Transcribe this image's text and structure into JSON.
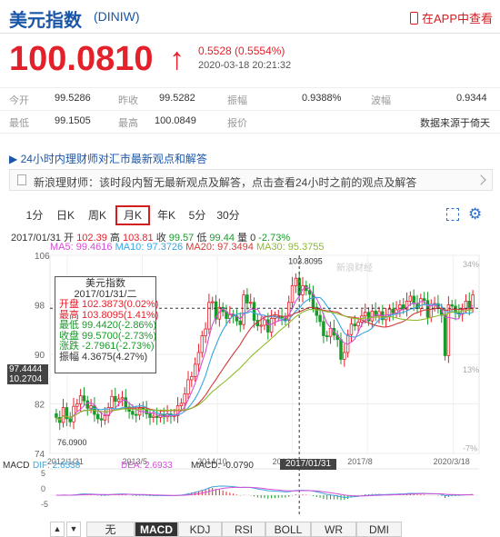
{
  "header": {
    "title": "美元指数",
    "code": "(DINIW)",
    "app_link": "在APP中查看"
  },
  "price": {
    "value": "100.0810",
    "arrow": "↑",
    "change": "0.5528 (0.5554%)",
    "timestamp": "2020-03-18 20:21:32"
  },
  "stats": [
    {
      "l1": "今开",
      "v1": "99.5286",
      "l2": "昨收",
      "v2": "99.5282",
      "l3": "振幅",
      "v3": "0.9388%",
      "l4": "波幅",
      "v4": "0.9344"
    },
    {
      "l1": "最低",
      "v1": "99.1505",
      "l2": "最高",
      "v2": "100.0849",
      "l3": "报价",
      "v3": "",
      "l4": "",
      "v4": "数据来源于倚天"
    }
  ],
  "advisor": {
    "title": "24小时内理财师对汇市最新观点和解答",
    "message": "新浪理财师：该时段内暂无最新观点及解答，点击查看24小时之前的观点及解答"
  },
  "tabs": [
    "1分",
    "日K",
    "周K",
    "月K",
    "年K",
    "5分",
    "30分"
  ],
  "info": {
    "date": "2017/01/31",
    "open_label": "开",
    "open": "102.39",
    "high_label": "高",
    "high": "103.81",
    "close_label": "收",
    "close": "99.57",
    "low_label": "低",
    "low": "99.44",
    "vol_label": "量",
    "vol": "0",
    "pct": "-2.73%",
    "ma5": "MA5: 99.4616",
    "ma10": "MA10: 97.3726",
    "ma20": "MA20: 97.3494",
    "ma30": "MA30: 95.3755"
  },
  "tooltip": {
    "title": "美元指数",
    "date": "2017/01/31/二",
    "open": "开盘 102.3873(0.02%)",
    "high": "最高 103.8095(1.41%)",
    "low": "最低 99.4420(-2.86%)",
    "close": "收盘 99.5700(-2.73%)",
    "chg": "涨跌 -2.7961(-2.73%)",
    "amp": "振幅 4.3675(4.27%)"
  },
  "price_marker": {
    "line1": "97.4444",
    "line2": "10.2704"
  },
  "date_marker": "2017/01/31",
  "chart_data": {
    "type": "candlestick",
    "ylim": [
      74,
      106
    ],
    "y_ticks": [
      "106",
      "98",
      "90",
      "82",
      "74"
    ],
    "pct_ticks": [
      "34%",
      "13%",
      "-7%"
    ],
    "x_ticks": [
      "2012/1/31",
      "2013/5",
      "2014/10",
      "2016/3",
      "2017/8",
      "2020/3/18"
    ],
    "peak_label": "103.8095",
    "low_label": "76.0900",
    "watermark": "新浪财经",
    "closes": [
      79.8,
      79.0,
      81.4,
      79.6,
      79.1,
      81.6,
      82.0,
      83.3,
      82.5,
      81.3,
      81.7,
      80.3,
      79.6,
      79.4,
      80.1,
      81.4,
      83.2,
      82.4,
      82.8,
      83.0,
      81.5,
      80.8,
      80.3,
      80.2,
      81.3,
      81.1,
      80.4,
      79.8,
      80.0,
      79.8,
      80.3,
      79.9,
      80.4,
      80.0,
      80.1,
      81.7,
      82.1,
      83.6,
      85.9,
      86.4,
      88.4,
      90.3,
      93.0,
      94.1,
      98.4,
      98.5,
      95.7,
      97.6,
      96.9,
      95.8,
      96.4,
      96.2,
      95.4,
      94.8,
      99.6,
      98.3,
      98.4,
      95.5,
      94.6,
      94.7,
      95.6,
      93.6,
      95.8,
      96.1,
      96.1,
      95.9,
      95.5,
      98.4,
      101.1,
      102.3,
      99.6,
      101.1,
      100.3,
      99.7,
      97.6,
      96.3,
      95.3,
      93.0,
      92.9,
      94.2,
      93.1,
      92.4,
      89.2,
      90.3,
      93.2,
      94.9,
      94.6,
      95.2,
      96.2,
      96.8,
      95.4,
      97.0,
      96.2,
      96.9,
      95.6,
      96.1,
      97.3,
      96.7,
      97.2,
      98.0,
      97.3,
      98.6,
      99.4,
      98.2,
      97.4,
      99.0,
      98.7,
      96.0,
      98.1,
      98.2,
      97.4,
      96.3,
      89.8,
      98.0,
      97.8,
      96.7,
      96.5,
      97.4,
      98.6,
      97.5,
      99.6
    ],
    "ma_series": [
      {
        "name": "MA5",
        "color": "#d44fd7"
      },
      {
        "name": "MA10",
        "color": "#3aa5e0"
      },
      {
        "name": "MA20",
        "color": "#d23c3c"
      },
      {
        "name": "MA30",
        "color": "#8dbb2c"
      }
    ],
    "macd": {
      "dif": "DIF: 2.6538",
      "dea": "DEA: 2.6933",
      "macd": "MACD: -0.0790",
      "y_ticks": [
        "5",
        "0",
        "-5"
      ]
    }
  },
  "bottom_tabs": [
    "无",
    "MACD",
    "KDJ",
    "RSI",
    "BOLL",
    "WR",
    "DMI"
  ],
  "colors": {
    "up": "#e4202a",
    "down": "#1a9a2a",
    "brand": "#1a56a8"
  }
}
